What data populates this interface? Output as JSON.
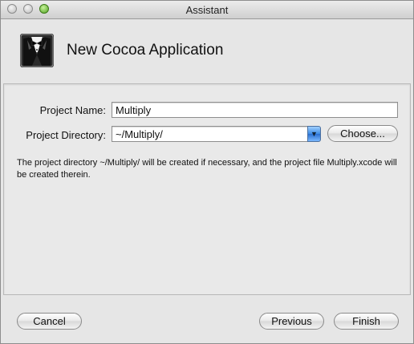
{
  "window": {
    "title": "Assistant"
  },
  "header": {
    "title": "New Cocoa Application",
    "icon": "tuxedo-icon"
  },
  "form": {
    "project_name_label": "Project Name:",
    "project_name_value": "Multiply",
    "project_directory_label": "Project Directory:",
    "project_directory_value": "~/Multiply/",
    "choose_label": "Choose...",
    "info_text": "The project directory ~/Multiply/ will be created if necessary, and the project file Multiply.xcode will be created therein."
  },
  "footer": {
    "cancel_label": "Cancel",
    "previous_label": "Previous",
    "finish_label": "Finish"
  }
}
